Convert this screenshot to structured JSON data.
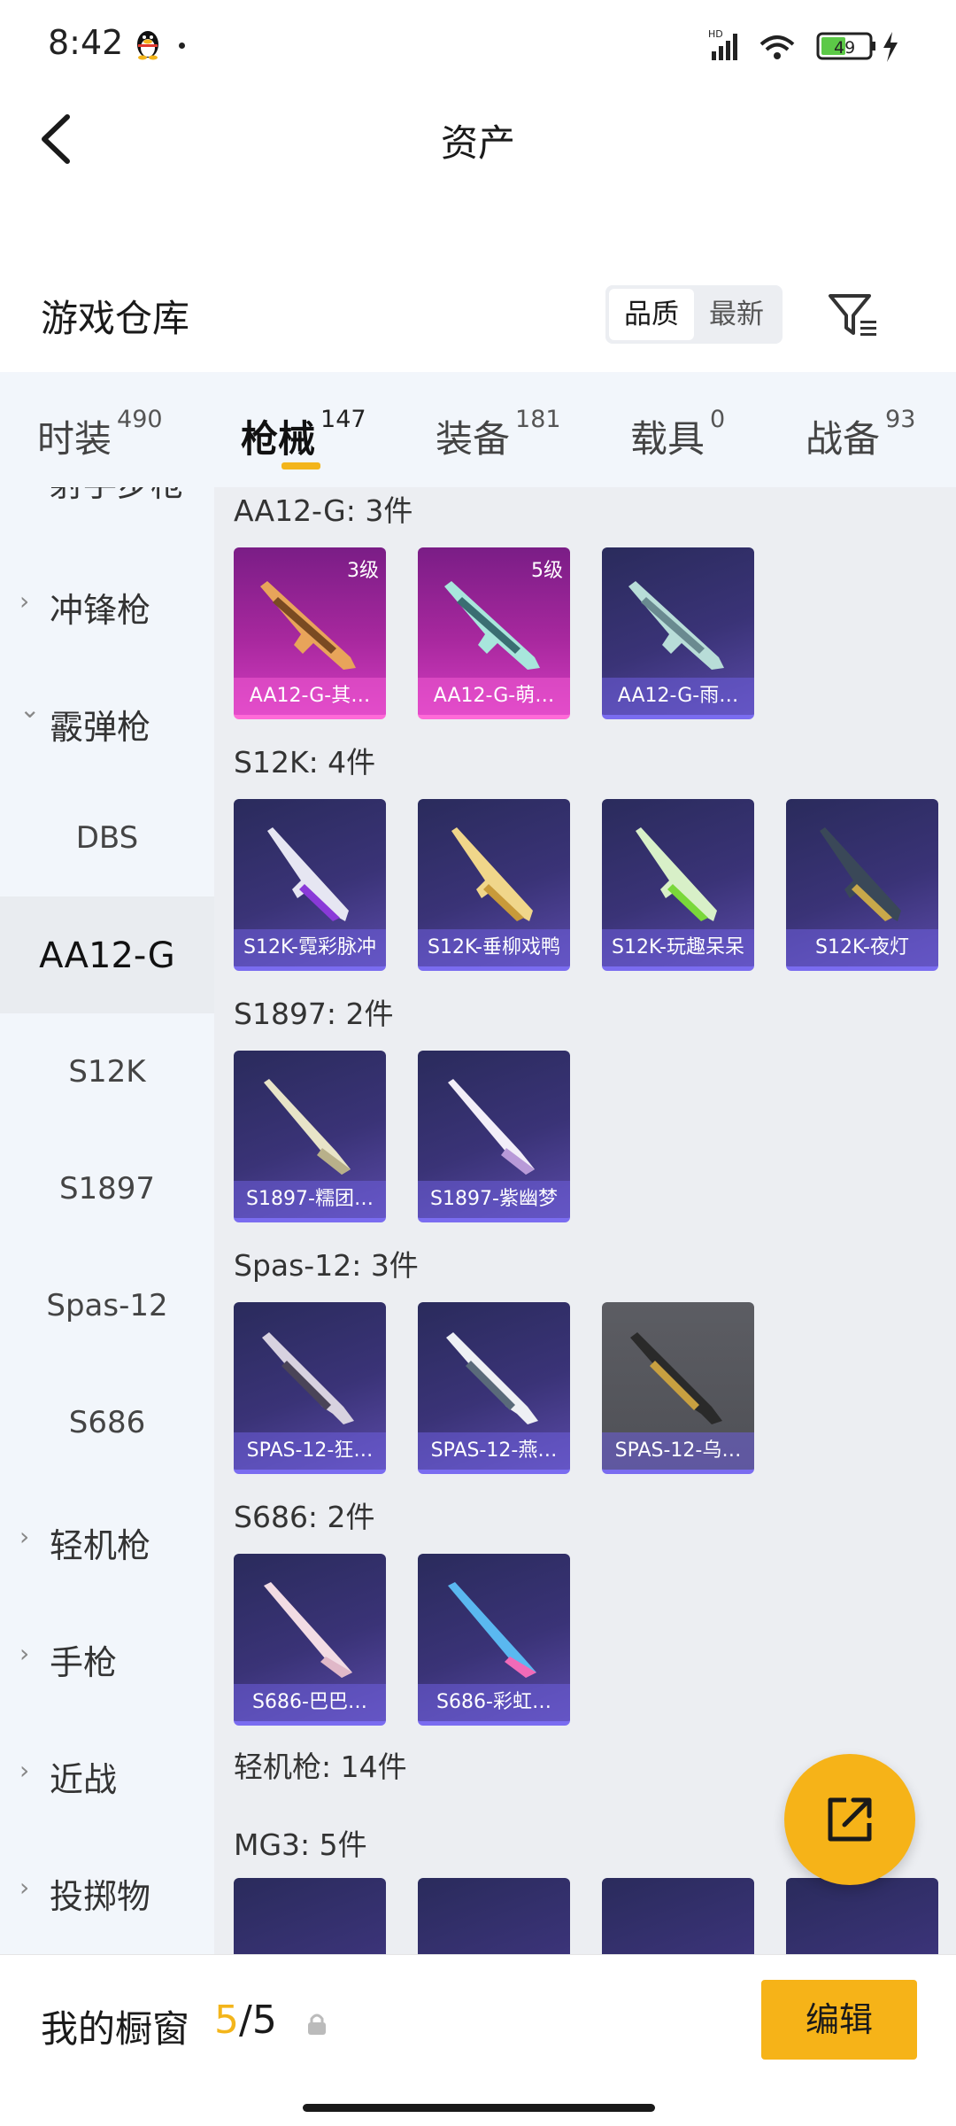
{
  "status_bar": {
    "time": "8:42",
    "battery": "49",
    "network": "HD"
  },
  "header": {
    "title": "资产",
    "back_icon": "chevron-left-icon"
  },
  "warehouse": {
    "title": "游戏仓库",
    "sort_options": [
      "品质",
      "最新"
    ],
    "selected_sort": "品质",
    "filter_icon": "filter-icon"
  },
  "category_tabs": [
    {
      "label": "时装",
      "count": "490"
    },
    {
      "label": "枪械",
      "count": "147"
    },
    {
      "label": "装备",
      "count": "181"
    },
    {
      "label": "载具",
      "count": "0"
    },
    {
      "label": "战备",
      "count": "93"
    }
  ],
  "active_tab": "枪械",
  "sidebar": {
    "items": [
      {
        "label": "射手步枪",
        "type": "parent",
        "expanded": true
      },
      {
        "label": "冲锋枪",
        "type": "parent",
        "expanded": false
      },
      {
        "label": "霰弹枪",
        "type": "parent",
        "expanded": true
      },
      {
        "label": "DBS",
        "type": "child"
      },
      {
        "label": "AA12-G",
        "type": "child",
        "active": true
      },
      {
        "label": "S12K",
        "type": "child"
      },
      {
        "label": "S1897",
        "type": "child"
      },
      {
        "label": "Spas-12",
        "type": "child"
      },
      {
        "label": "S686",
        "type": "child"
      },
      {
        "label": "轻机枪",
        "type": "parent",
        "expanded": false
      },
      {
        "label": "手枪",
        "type": "parent",
        "expanded": false
      },
      {
        "label": "近战",
        "type": "parent",
        "expanded": false
      },
      {
        "label": "投掷物",
        "type": "parent",
        "expanded": false
      }
    ]
  },
  "groups": [
    {
      "title": "AA12-G: 3件",
      "items": [
        {
          "name": "AA12-G-其…",
          "level": "3级",
          "rarity": "purple"
        },
        {
          "name": "AA12-G-萌…",
          "level": "5级",
          "rarity": "purple"
        },
        {
          "name": "AA12-G-雨…",
          "level": "",
          "rarity": "blue"
        }
      ]
    },
    {
      "title": "S12K: 4件",
      "items": [
        {
          "name": "S12K-霓彩脉冲",
          "level": "",
          "rarity": "blue"
        },
        {
          "name": "S12K-垂柳戏鸭",
          "level": "",
          "rarity": "blue"
        },
        {
          "name": "S12K-玩趣呆呆",
          "level": "",
          "rarity": "blue"
        },
        {
          "name": "S12K-夜灯",
          "level": "",
          "rarity": "blue"
        }
      ]
    },
    {
      "title": "S1897: 2件",
      "items": [
        {
          "name": "S1897-糯团…",
          "level": "",
          "rarity": "blue"
        },
        {
          "name": "S1897-紫幽梦",
          "level": "",
          "rarity": "blue"
        }
      ]
    },
    {
      "title": "Spas-12: 3件",
      "items": [
        {
          "name": "SPAS-12-狂…",
          "level": "",
          "rarity": "blue"
        },
        {
          "name": "SPAS-12-燕…",
          "level": "",
          "rarity": "blue"
        },
        {
          "name": "SPAS-12-乌…",
          "level": "",
          "rarity": "grey"
        }
      ]
    },
    {
      "title": "S686: 2件",
      "items": [
        {
          "name": "S686-巴巴…",
          "level": "",
          "rarity": "blue"
        },
        {
          "name": "S686-彩虹…",
          "level": "",
          "rarity": "blue"
        }
      ]
    }
  ],
  "section_light_mg": "轻机枪: 14件",
  "mg3_group": {
    "title": "MG3: 5件"
  },
  "share_icon": "share-icon",
  "bottom": {
    "showcase_label": "我的橱窗",
    "showcase_current": "5",
    "showcase_total": "/5",
    "lock_icon": "lock-icon",
    "edit_label": "编辑"
  },
  "colors": {
    "accent": "#f3b51b",
    "card_blue": "#3a3377",
    "card_purple": "#a8289e"
  }
}
